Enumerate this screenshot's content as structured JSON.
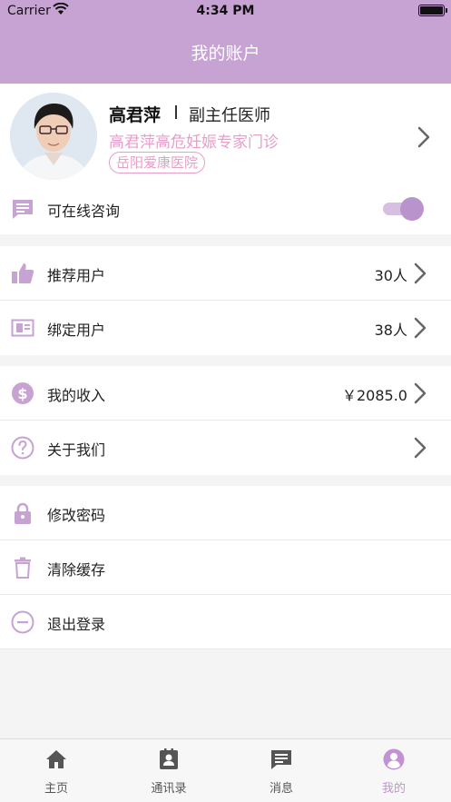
{
  "status_bar": {
    "carrier": "Carrier",
    "time": "4:34 PM"
  },
  "header": {
    "title": "我的账户"
  },
  "profile": {
    "name": "高君萍",
    "title": "副主任医师",
    "clinic": "高君萍高危妊娠专家门诊",
    "hospital": "岳阳爱康医院"
  },
  "consult": {
    "label": "可在线咨询",
    "enabled": true
  },
  "menu": {
    "group1": [
      {
        "label": "推荐用户",
        "value": "30人",
        "icon": "thumbs-up-icon"
      },
      {
        "label": "绑定用户",
        "value": "38人",
        "icon": "id-card-icon"
      }
    ],
    "group2": [
      {
        "label": "我的收入",
        "value": "￥2085.0",
        "icon": "dollar-circle-icon"
      },
      {
        "label": "关于我们",
        "value": "",
        "icon": "question-circle-icon"
      }
    ],
    "group3": [
      {
        "label": "修改密码",
        "icon": "lock-icon"
      },
      {
        "label": "清除缓存",
        "icon": "trash-icon"
      },
      {
        "label": "退出登录",
        "icon": "minus-circle-icon"
      }
    ]
  },
  "tabs": [
    {
      "label": "主页",
      "icon": "home-icon"
    },
    {
      "label": "通讯录",
      "icon": "contacts-icon"
    },
    {
      "label": "消息",
      "icon": "message-icon"
    },
    {
      "label": "我的",
      "icon": "user-icon",
      "active": true
    }
  ],
  "colors": {
    "accent": "#c7a3d3",
    "icon": "#c7a3d3",
    "pink": "#e79ec9",
    "active_tab": "#c292d4"
  }
}
